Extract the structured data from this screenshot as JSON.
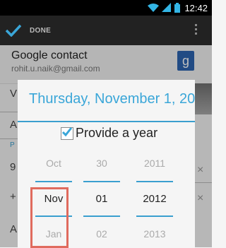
{
  "status_bar": {
    "time": "12:42"
  },
  "action_bar": {
    "done_label": "DONE"
  },
  "account": {
    "name": "Google contact",
    "email": "rohit.u.naik@gmail.com",
    "badge_letter": "g"
  },
  "background_letters": [
    "V",
    "A",
    "P",
    "9",
    "+",
    "A"
  ],
  "background_close": "×",
  "dialog": {
    "title": "Thursday, November 1, 20...",
    "provide_year_label": "Provide a year",
    "provide_year_checked": true,
    "pickers": {
      "month": {
        "above": "Oct",
        "selected": "Nov",
        "below": "Jan"
      },
      "day": {
        "above": "30",
        "selected": "01",
        "below": "02"
      },
      "year": {
        "above": "2011",
        "selected": "2012",
        "below": "2013"
      }
    }
  },
  "colors": {
    "accent": "#3a9fcf",
    "highlight": "#e06b5e"
  }
}
